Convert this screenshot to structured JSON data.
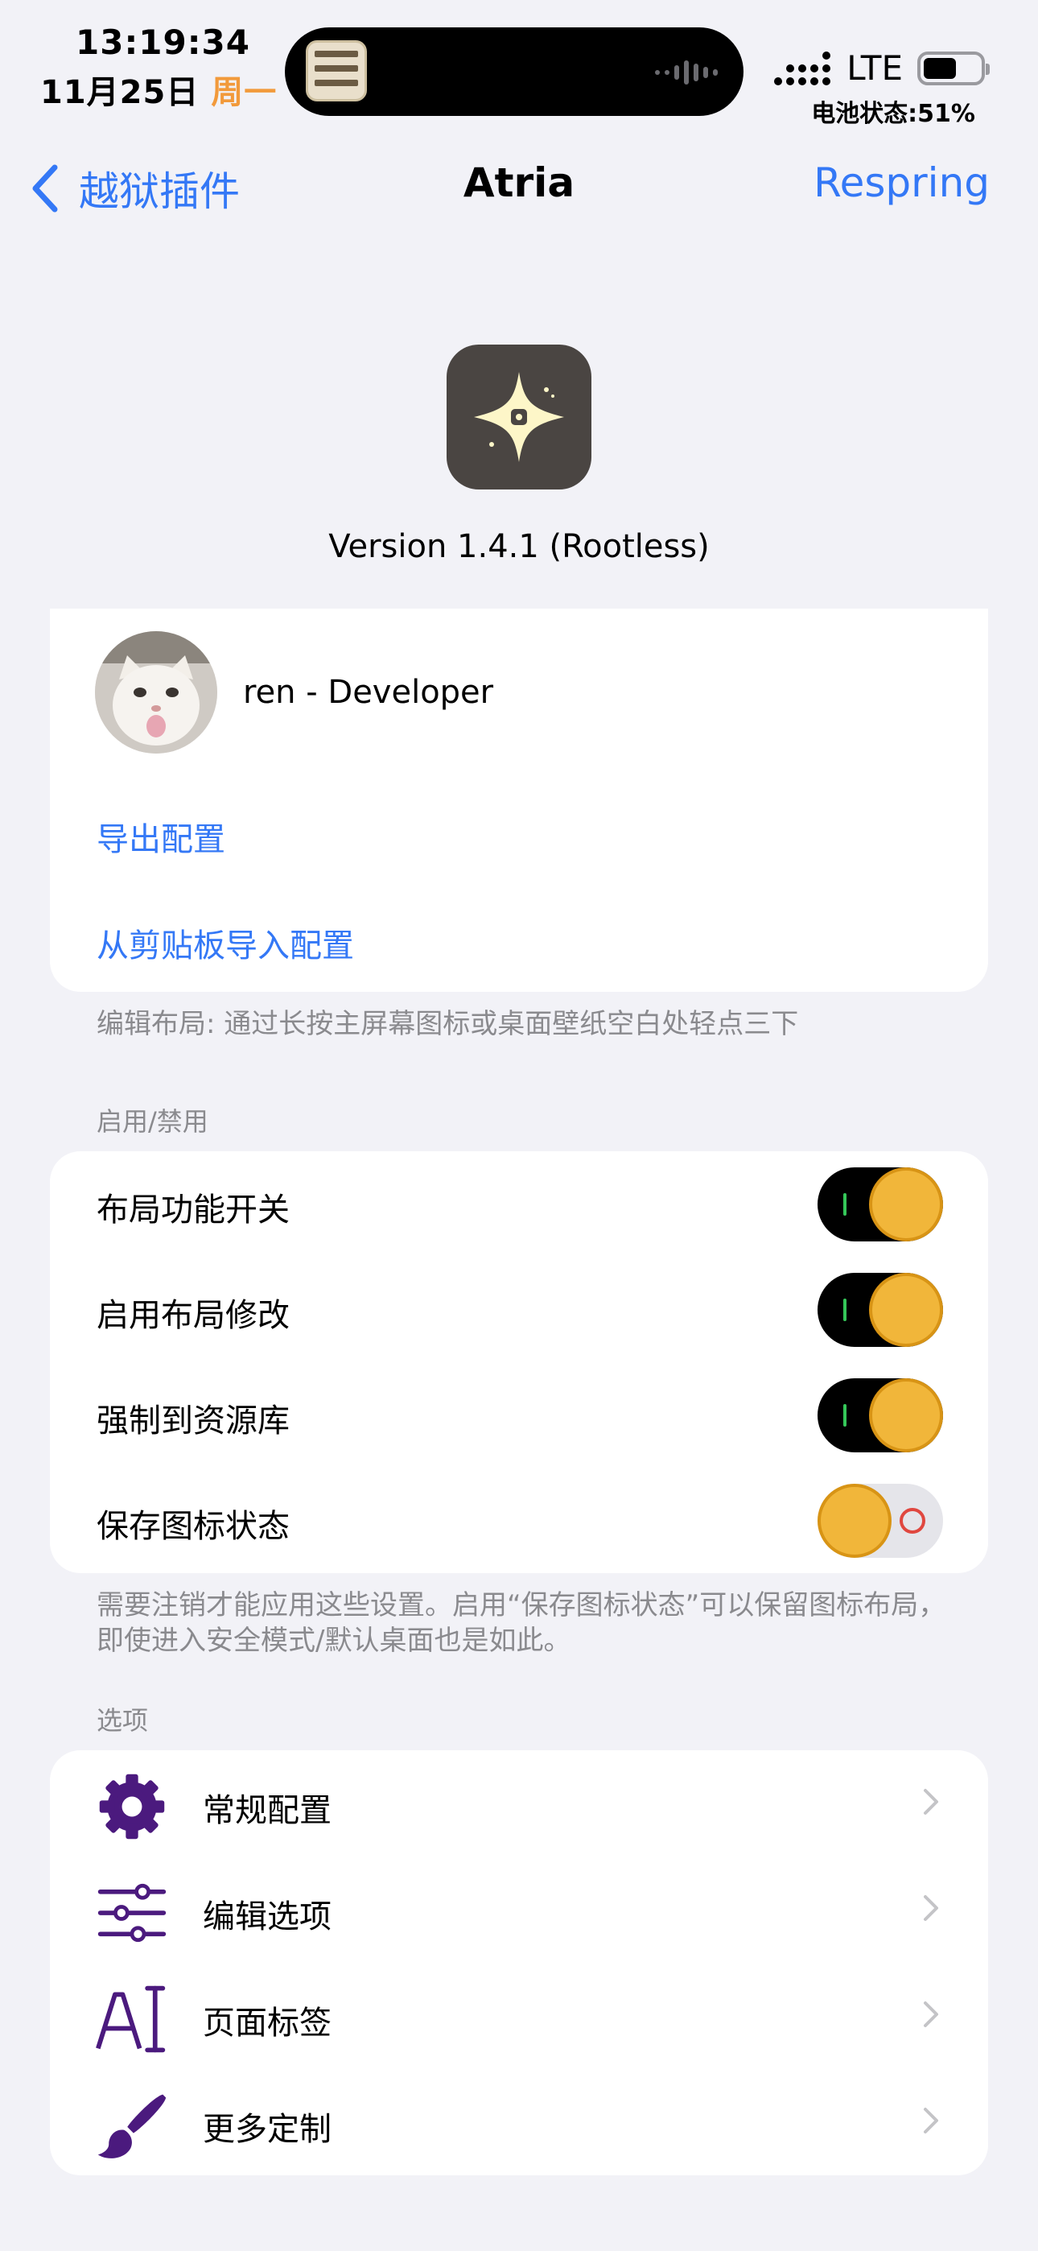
{
  "status_bar": {
    "time": "13:19:34",
    "date": "11月25日",
    "weekday": "周一",
    "network": "LTE",
    "battery_text": "电池状态:51%",
    "battery_level": 0.51
  },
  "nav": {
    "back_label": "越狱插件",
    "title": "Atria",
    "right_label": "Respring"
  },
  "header": {
    "version": "Version 1.4.1 (Rootless)"
  },
  "developer": {
    "name": "ren - Developer"
  },
  "actions": {
    "export": "导出配置",
    "import": "从剪贴板导入配置"
  },
  "notes": {
    "layout_hint": "编辑布局: 通过长按主屏幕图标或桌面壁纸空白处轻点三下",
    "toggle_footer": "需要注销才能应用这些设置。启用“保存图标状态”可以保留图标布局，即使进入安全模式/默认桌面也是如此。"
  },
  "sections": {
    "enable": "启用/禁用",
    "options": "选项"
  },
  "toggles": [
    {
      "label": "布局功能开关",
      "on": true
    },
    {
      "label": "启用布局修改",
      "on": true
    },
    {
      "label": "强制到资源库",
      "on": true
    },
    {
      "label": "保存图标状态",
      "on": false
    }
  ],
  "options": [
    {
      "label": "常规配置",
      "icon": "gear-icon"
    },
    {
      "label": "编辑选项",
      "icon": "sliders-icon"
    },
    {
      "label": "页面标签",
      "icon": "text-cursor-icon"
    },
    {
      "label": "更多定制",
      "icon": "paintbrush-icon"
    }
  ],
  "colors": {
    "accent": "#3478f6",
    "icon_purple": "#4b1a7e",
    "weekday": "#f29a3b",
    "background": "#f2f2f7"
  }
}
